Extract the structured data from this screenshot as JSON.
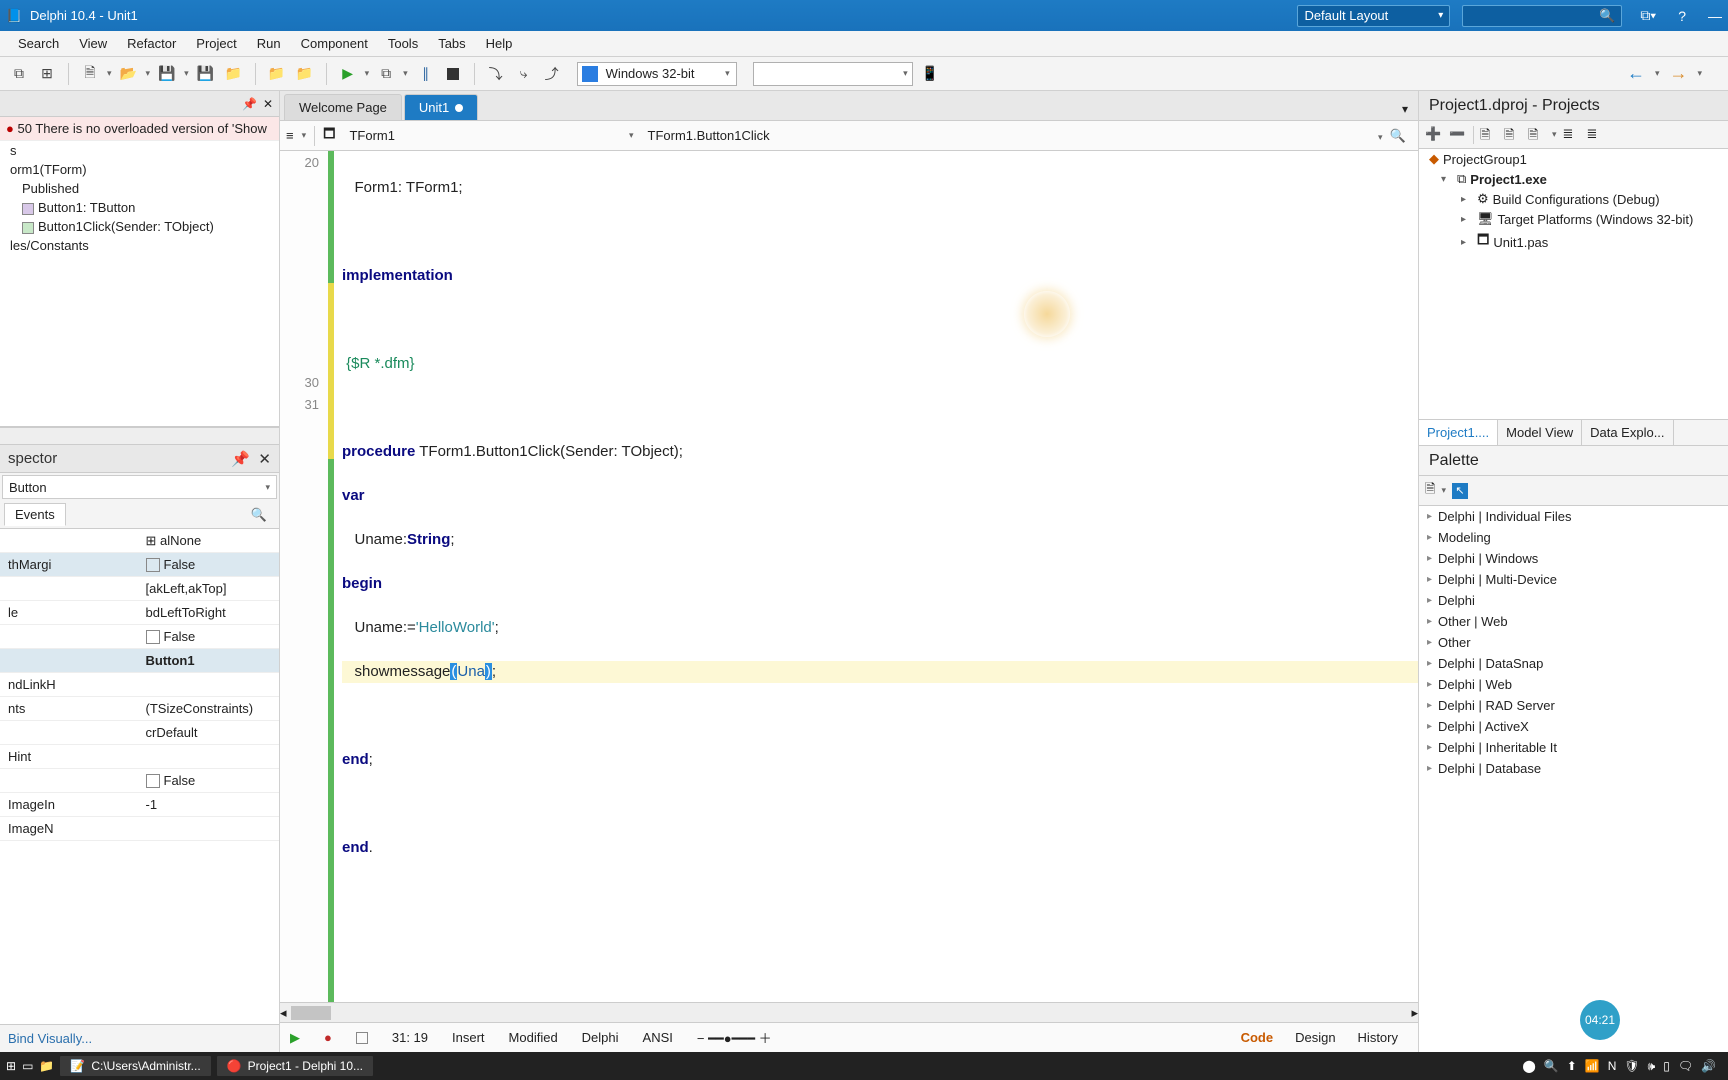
{
  "title": "Delphi 10.4 - Unit1",
  "layout_selector": "Default Layout",
  "menu": [
    "Search",
    "View",
    "Refactor",
    "Project",
    "Run",
    "Component",
    "Tools",
    "Tabs",
    "Help"
  ],
  "platform": "Windows 32-bit",
  "tabs": {
    "welcome": "Welcome Page",
    "active": "Unit1"
  },
  "nav": {
    "class": "TForm1",
    "method": "TForm1.Button1Click"
  },
  "gutter": {
    "l20": "20",
    "l30": "30",
    "l31": "31"
  },
  "code": {
    "l1a": "Form1: TForm1;",
    "l2a": "implementation",
    "l3a": "{$R *.dfm}",
    "l4a": "procedure",
    "l4b": " TForm1.Button1Click(Sender: TObject);",
    "l5a": "var",
    "l6a": "   Uname:",
    "l6b": "String",
    "l6c": ";",
    "l7a": "begin",
    "l8a": "   Uname:=",
    "l8b": "'HelloWorld'",
    "l8c": ";",
    "l9a": "   showmessage",
    "l9b": "(",
    "l9c": "Una",
    "l9d": ")",
    "l9e": ";",
    "l10a": "end",
    "l10b": ";",
    "l11a": "end",
    "l11b": "."
  },
  "status": {
    "pos": "31: 19",
    "mode": "Insert",
    "modified": "Modified",
    "lang": "Delphi",
    "enc": "ANSI",
    "t_code": "Code",
    "t_design": "Design",
    "t_history": "History"
  },
  "structure": {
    "error": "50 There is no overloaded version of 'Show",
    "errtail": "s",
    "n1": "orm1(TForm)",
    "n2": "Published",
    "n3": "Button1: TButton",
    "n4": "Button1Click(Sender: TObject)",
    "n5": "les/Constants"
  },
  "inspector": {
    "title": "spector",
    "combo": "Button",
    "tab_events": "Events",
    "rows": [
      {
        "name": "",
        "val": "alNone",
        "check": false,
        "expand": true
      },
      {
        "name": "thMargi",
        "val": "False",
        "check": true
      },
      {
        "name": "",
        "val": "[akLeft,akTop]"
      },
      {
        "name": "le",
        "val": "bdLeftToRight"
      },
      {
        "name": "",
        "val": "False",
        "check": true
      },
      {
        "name": "",
        "val": "Button1",
        "bold": true,
        "hl": true
      },
      {
        "name": "ndLinkH",
        "val": ""
      },
      {
        "name": "nts",
        "val": "(TSizeConstraints)"
      },
      {
        "name": "",
        "val": "crDefault"
      },
      {
        "name": "Hint",
        "val": ""
      },
      {
        "name": "",
        "val": "False",
        "check": true
      },
      {
        "name": "ImageIn",
        "val": "-1"
      },
      {
        "name": "ImageN",
        "val": ""
      }
    ],
    "bind": "Bind Visually..."
  },
  "projects": {
    "title": "Project1.dproj - Projects",
    "root": "ProjectGroup1",
    "exe": "Project1.exe",
    "build": "Build Configurations (Debug)",
    "target": "Target Platforms (Windows 32-bit)",
    "unit": "Unit1.pas",
    "tabs": {
      "p": "Project1....",
      "m": "Model View",
      "d": "Data Explo..."
    }
  },
  "palette": {
    "title": "Palette",
    "cats": [
      "Delphi | Individual Files",
      "Modeling",
      "Delphi | Windows",
      "Delphi | Multi-Device",
      "Delphi",
      "Other | Web",
      "Other",
      "Delphi | DataSnap",
      "Delphi | Web",
      "Delphi | RAD Server",
      "Delphi | ActiveX",
      "Delphi | Inheritable It",
      "Delphi | Database"
    ]
  },
  "taskbar": {
    "path": "C:\\Users\\Administr...",
    "app": "Project1 - Delphi 10..."
  },
  "time_badge": "04:21"
}
